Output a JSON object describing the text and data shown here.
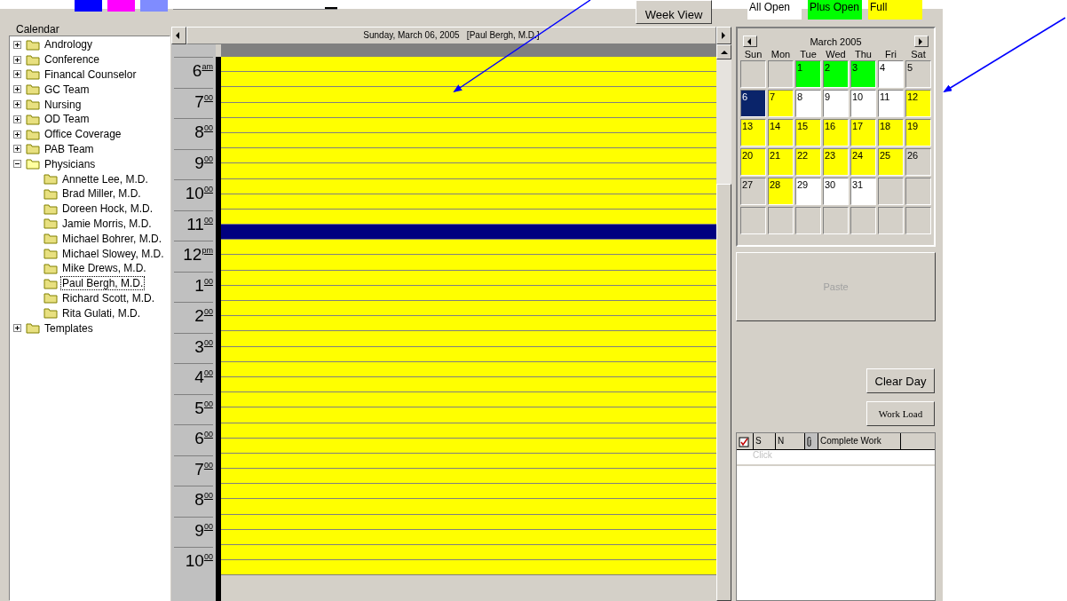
{
  "toolbar": {
    "swatches": [
      {
        "color": "#0000ff"
      },
      {
        "color": "#ff00ff"
      },
      {
        "color": "#7f8cff"
      }
    ],
    "week_view_button": "Week View"
  },
  "legend": [
    {
      "label": "All Open",
      "color": "#ffffff"
    },
    {
      "label": "Plus Open",
      "color": "#00ff00"
    },
    {
      "label": "Full",
      "color": "#ffff00"
    }
  ],
  "sidebar": {
    "title": "Calendar",
    "items": [
      {
        "label": "Andrology",
        "expanded": false,
        "selected": false
      },
      {
        "label": "Conference",
        "expanded": false,
        "selected": false
      },
      {
        "label": "Financal Counselor",
        "expanded": false,
        "selected": false
      },
      {
        "label": "GC Team",
        "expanded": false,
        "selected": false
      },
      {
        "label": "Nursing",
        "expanded": false,
        "selected": false
      },
      {
        "label": "OD Team",
        "expanded": false,
        "selected": false
      },
      {
        "label": "Office Coverage",
        "expanded": false,
        "selected": false
      },
      {
        "label": "PAB Team",
        "expanded": false,
        "selected": false
      },
      {
        "label": "Physicians",
        "expanded": true,
        "selected": false,
        "children": [
          {
            "label": "Annette Lee, M.D.",
            "selected": false
          },
          {
            "label": "Brad Miller,  M.D.",
            "selected": false
          },
          {
            "label": "Doreen Hock, M.D.",
            "selected": false
          },
          {
            "label": "Jamie Morris, M.D.",
            "selected": false
          },
          {
            "label": "Michael Bohrer, M.D.",
            "selected": false
          },
          {
            "label": "Michael Slowey, M.D.",
            "selected": false
          },
          {
            "label": "Mike Drews, M.D.",
            "selected": false
          },
          {
            "label": "Paul Bergh, M.D.",
            "selected": true
          },
          {
            "label": "Richard Scott, M.D.",
            "selected": false
          },
          {
            "label": "Rita Gulati, M.D.",
            "selected": false
          }
        ]
      },
      {
        "label": "Templates",
        "expanded": false,
        "selected": false
      }
    ]
  },
  "day_view": {
    "header": "Sunday, March 06, 2005   [Paul Bergh, M.D.]",
    "hours": [
      "6$^{am}$",
      "7$^{00}$",
      "8$^{00}$",
      "9$^{00}$",
      "10$^{00}$",
      "11$^{00}$",
      "12$^{pm}$",
      "1$^{00}$",
      "2$^{00}$",
      "3$^{00}$",
      "4$^{00}$",
      "5$^{00}$",
      "6$^{00}$",
      "7$^{00}$",
      "8$^{00}$",
      "9$^{00}$",
      "10$^{00}$"
    ],
    "slots": [
      {
        "selected": false
      },
      {
        "selected": false
      },
      {
        "selected": false
      },
      {
        "selected": false
      },
      {
        "selected": false
      },
      {
        "selected": false
      },
      {
        "selected": false
      },
      {
        "selected": false
      },
      {
        "selected": false
      },
      {
        "selected": false
      },
      {
        "selected": false
      },
      {
        "selected": true
      },
      {
        "selected": false
      },
      {
        "selected": false
      },
      {
        "selected": false
      },
      {
        "selected": false
      },
      {
        "selected": false
      },
      {
        "selected": false
      },
      {
        "selected": false
      },
      {
        "selected": false
      },
      {
        "selected": false
      },
      {
        "selected": false
      },
      {
        "selected": false
      },
      {
        "selected": false
      },
      {
        "selected": false
      },
      {
        "selected": false
      },
      {
        "selected": false
      },
      {
        "selected": false
      },
      {
        "selected": false
      },
      {
        "selected": false
      },
      {
        "selected": false
      },
      {
        "selected": false
      },
      {
        "selected": false
      },
      {
        "selected": false
      }
    ]
  },
  "mini_calendar": {
    "title": "March 2005",
    "weekdays": [
      "Sun",
      "Mon",
      "Tue",
      "Wed",
      "Thu",
      "Fri",
      "Sat"
    ],
    "days": [
      {
        "kind": "blank"
      },
      {
        "kind": "blank"
      },
      {
        "kind": "plus_open",
        "day": "1",
        "selected": false
      },
      {
        "kind": "plus_open",
        "day": "2",
        "selected": false
      },
      {
        "kind": "plus_open",
        "day": "3",
        "selected": false
      },
      {
        "kind": "all_open",
        "day": "4",
        "selected": false
      },
      {
        "kind": "closed",
        "day": "5",
        "selected": false
      },
      {
        "kind": "full",
        "day": "6",
        "selected": true
      },
      {
        "kind": "full",
        "day": "7",
        "selected": false
      },
      {
        "kind": "all_open",
        "day": "8",
        "selected": false
      },
      {
        "kind": "all_open",
        "day": "9",
        "selected": false
      },
      {
        "kind": "all_open",
        "day": "10",
        "selected": false
      },
      {
        "kind": "all_open",
        "day": "11",
        "selected": false
      },
      {
        "kind": "full",
        "day": "12",
        "selected": false
      },
      {
        "kind": "full",
        "day": "13",
        "selected": false
      },
      {
        "kind": "full",
        "day": "14",
        "selected": false
      },
      {
        "kind": "full",
        "day": "15",
        "selected": false
      },
      {
        "kind": "full",
        "day": "16",
        "selected": false
      },
      {
        "kind": "full",
        "day": "17",
        "selected": false
      },
      {
        "kind": "full",
        "day": "18",
        "selected": false
      },
      {
        "kind": "full",
        "day": "19",
        "selected": false
      },
      {
        "kind": "full",
        "day": "20",
        "selected": false
      },
      {
        "kind": "full",
        "day": "21",
        "selected": false
      },
      {
        "kind": "full",
        "day": "22",
        "selected": false
      },
      {
        "kind": "full",
        "day": "23",
        "selected": false
      },
      {
        "kind": "full",
        "day": "24",
        "selected": false
      },
      {
        "kind": "full",
        "day": "25",
        "selected": false
      },
      {
        "kind": "closed",
        "day": "26",
        "selected": false
      },
      {
        "kind": "closed",
        "day": "27",
        "selected": false
      },
      {
        "kind": "full",
        "day": "28",
        "selected": false
      },
      {
        "kind": "all_open",
        "day": "29",
        "selected": false
      },
      {
        "kind": "all_open",
        "day": "30",
        "selected": false
      },
      {
        "kind": "all_open",
        "day": "31",
        "selected": false
      },
      {
        "kind": "blank"
      },
      {
        "kind": "blank"
      },
      {
        "kind": "blank"
      },
      {
        "kind": "blank"
      },
      {
        "kind": "blank"
      },
      {
        "kind": "blank"
      },
      {
        "kind": "blank"
      },
      {
        "kind": "blank"
      },
      {
        "kind": "blank"
      }
    ]
  },
  "paste_button": {
    "label": "Paste",
    "disabled": true
  },
  "clear_day_button": "Clear Day",
  "work_load_button": "Work Load",
  "task_table": {
    "columns": [
      {
        "kind": "icon"
      },
      {
        "kind": "text",
        "label": "S"
      },
      {
        "kind": "text",
        "label": "N"
      },
      {
        "kind": "clip"
      },
      {
        "kind": "text",
        "label": "Complete Work"
      },
      {
        "kind": "blank"
      }
    ],
    "new_row_placeholder": "Click"
  }
}
